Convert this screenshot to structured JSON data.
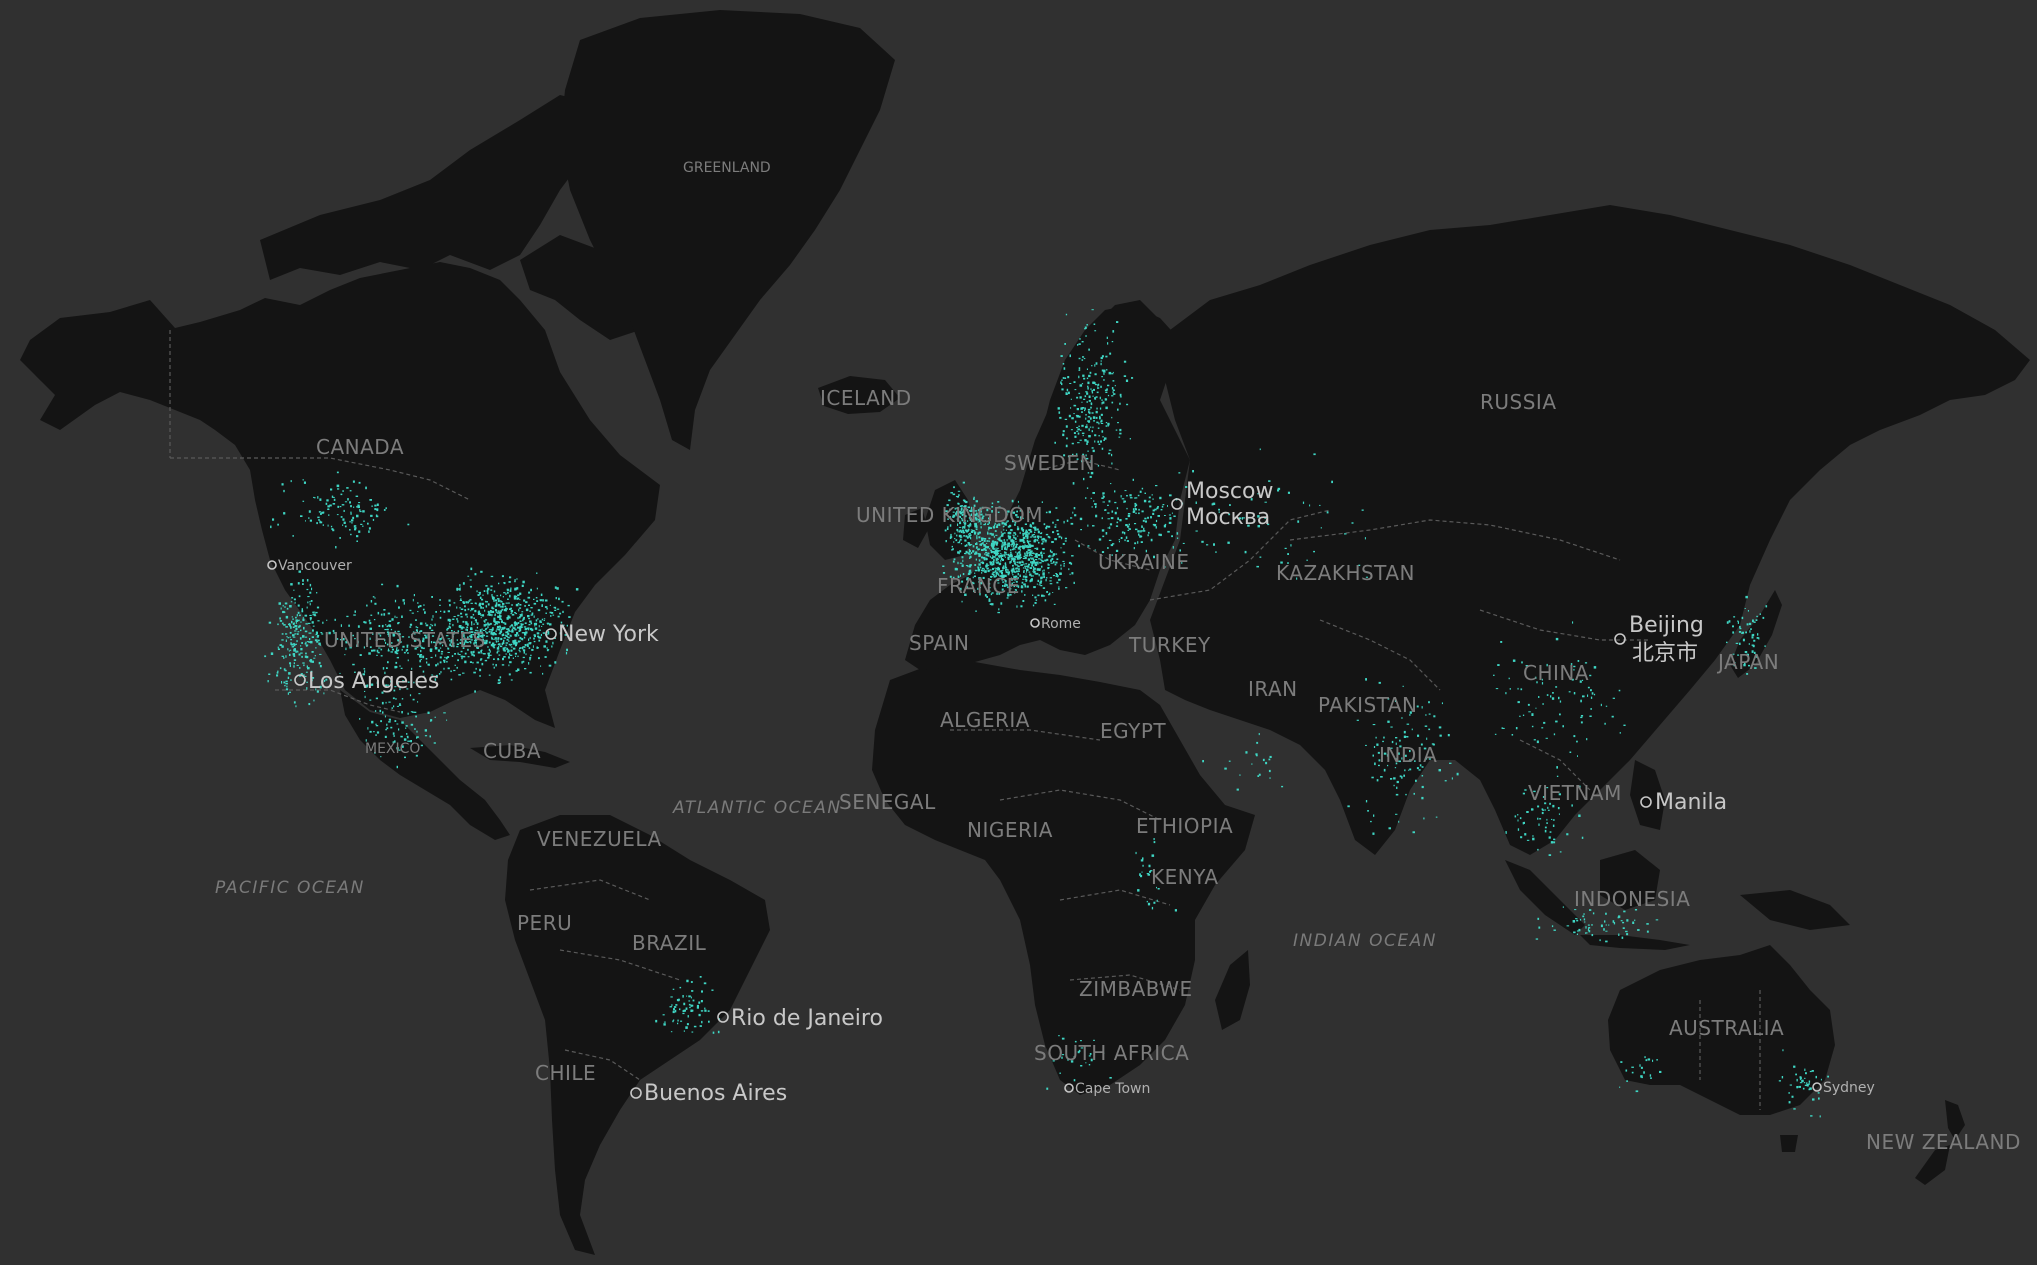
{
  "map": {
    "background_color": "#303030",
    "land_color": "#141414",
    "border_color": "#5a5a5a",
    "point_color": "#3fd6c4",
    "label_color": "#7c7c7c",
    "city_label_color": "#c8c8c8"
  },
  "countries": [
    {
      "id": "greenland",
      "label": "GREENLAND"
    },
    {
      "id": "iceland",
      "label": "ICELAND"
    },
    {
      "id": "canada",
      "label": "CANADA"
    },
    {
      "id": "united-states",
      "label": "UNITED STATES"
    },
    {
      "id": "mexico",
      "label": "MEXICO"
    },
    {
      "id": "cuba",
      "label": "CUBA"
    },
    {
      "id": "venezuela",
      "label": "VENEZUELA"
    },
    {
      "id": "peru",
      "label": "PERU"
    },
    {
      "id": "brazil",
      "label": "BRAZIL"
    },
    {
      "id": "chile",
      "label": "CHILE"
    },
    {
      "id": "russia",
      "label": "RUSSIA"
    },
    {
      "id": "sweden",
      "label": "SWEDEN"
    },
    {
      "id": "united-kingdom",
      "label": "UNITED KINGDOM"
    },
    {
      "id": "france",
      "label": "FRANCE"
    },
    {
      "id": "spain",
      "label": "SPAIN"
    },
    {
      "id": "ukraine",
      "label": "UKRAINE"
    },
    {
      "id": "turkey",
      "label": "TURKEY"
    },
    {
      "id": "kazakhstan",
      "label": "KAZAKHSTAN"
    },
    {
      "id": "iran",
      "label": "IRAN"
    },
    {
      "id": "pakistan",
      "label": "PAKISTAN"
    },
    {
      "id": "india",
      "label": "INDIA"
    },
    {
      "id": "china",
      "label": "CHINA"
    },
    {
      "id": "japan",
      "label": "JAPAN"
    },
    {
      "id": "vietnam",
      "label": "VIETNAM"
    },
    {
      "id": "indonesia",
      "label": "INDONESIA"
    },
    {
      "id": "australia",
      "label": "AUSTRALIA"
    },
    {
      "id": "new-zealand",
      "label": "NEW ZEALAND"
    },
    {
      "id": "algeria",
      "label": "ALGERIA"
    },
    {
      "id": "egypt",
      "label": "EGYPT"
    },
    {
      "id": "senegal",
      "label": "SENEGAL"
    },
    {
      "id": "nigeria",
      "label": "NIGERIA"
    },
    {
      "id": "ethiopia",
      "label": "ETHIOPIA"
    },
    {
      "id": "kenya",
      "label": "KENYA"
    },
    {
      "id": "zimbabwe",
      "label": "ZIMBABWE"
    },
    {
      "id": "south-africa",
      "label": "SOUTH AFRICA"
    }
  ],
  "oceans": [
    {
      "id": "pacific",
      "label": "PACIFIC OCEAN"
    },
    {
      "id": "atlantic",
      "label": "ATLANTIC OCEAN"
    },
    {
      "id": "indian",
      "label": "INDIAN OCEAN"
    }
  ],
  "cities": [
    {
      "id": "new-york",
      "label": "New York"
    },
    {
      "id": "los-angeles",
      "label": "Los Angeles"
    },
    {
      "id": "vancouver",
      "label": "Vancouver"
    },
    {
      "id": "rio",
      "label": "Rio de Janeiro"
    },
    {
      "id": "buenos-aires",
      "label": "Buenos Aires"
    },
    {
      "id": "moscow",
      "label": "Moscow",
      "label_local": "Москва"
    },
    {
      "id": "rome",
      "label": "Rome"
    },
    {
      "id": "cape-town",
      "label": "Cape Town"
    },
    {
      "id": "beijing",
      "label": "Beijing",
      "label_local": "北京市"
    },
    {
      "id": "manila",
      "label": "Manila"
    },
    {
      "id": "sydney",
      "label": "Sydney"
    }
  ]
}
